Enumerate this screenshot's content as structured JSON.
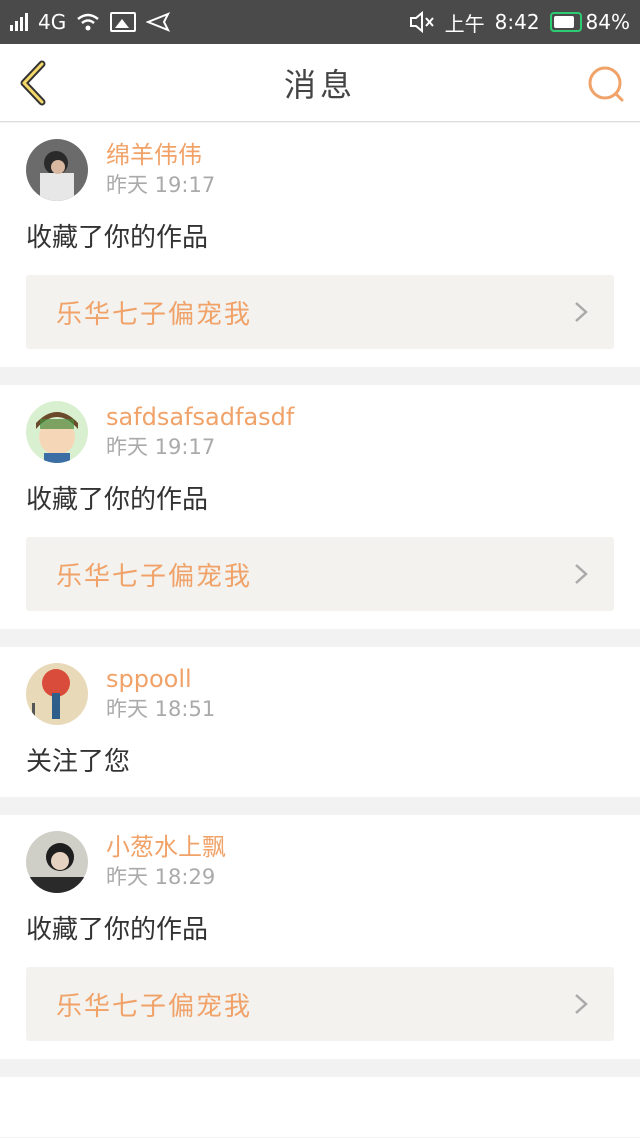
{
  "status_bar": {
    "network": "4G",
    "time_prefix": "上午",
    "time": "8:42",
    "battery": "84%",
    "battery_level": 0.84,
    "icons": [
      "signal-icon",
      "wifi-icon",
      "image-icon",
      "send-icon",
      "mute-icon"
    ]
  },
  "header": {
    "title": "消息",
    "back_icon": "chevron-left-icon",
    "search_icon": "search-icon",
    "accent_color": "#f0a268"
  },
  "notifications": [
    {
      "name": "绵羊伟伟",
      "time": "昨天 19:17",
      "action": "收藏了你的作品",
      "work": "乐华七子偏宠我"
    },
    {
      "name": "safdsafsadfasdf",
      "time": "昨天 19:17",
      "action": "收藏了你的作品",
      "work": "乐华七子偏宠我"
    },
    {
      "name": "sppooll",
      "time": "昨天 18:51",
      "action": "关注了您"
    },
    {
      "name": "小葱水上飘",
      "time": "昨天 18:29",
      "action": "收藏了你的作品",
      "work": "乐华七子偏宠我"
    }
  ]
}
